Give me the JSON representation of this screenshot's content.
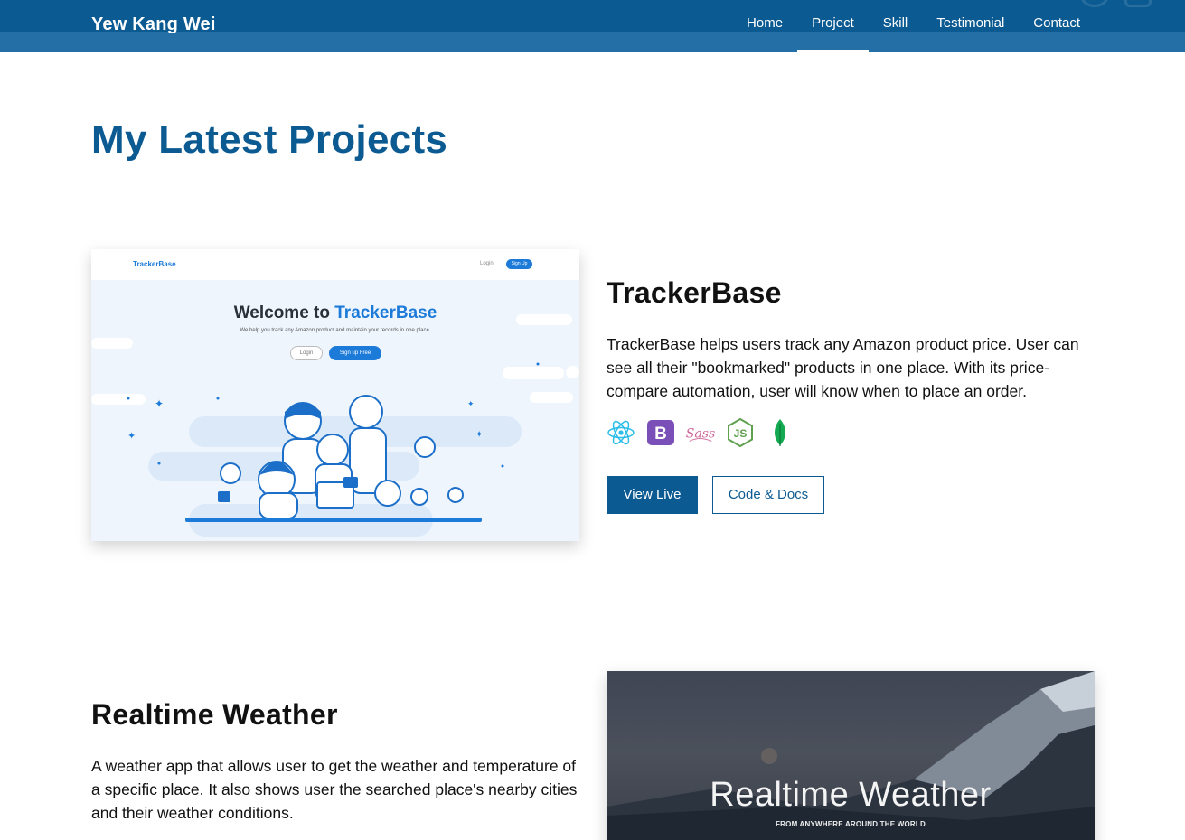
{
  "nav": {
    "brand": "Yew Kang Wei",
    "items": [
      {
        "label": "Home",
        "active": false
      },
      {
        "label": "Project",
        "active": true
      },
      {
        "label": "Skill",
        "active": false
      },
      {
        "label": "Testimonial",
        "active": false
      },
      {
        "label": "Contact",
        "active": false
      }
    ]
  },
  "section": {
    "title": "My Latest Projects"
  },
  "projects": [
    {
      "title": "TrackerBase",
      "description": "TrackerBase helps users track any Amazon product price. User can see all their \"bookmarked\" products in one place. With its price-compare automation, user will know when to place an order.",
      "techs": [
        "react-icon",
        "bootstrap-icon",
        "sass-icon",
        "nodejs-icon",
        "mongodb-icon"
      ],
      "buttons": {
        "live": "View Live",
        "code": "Code & Docs"
      },
      "screenshot": {
        "brand": "TrackerBase",
        "login": "Login",
        "signup": "Sign Up",
        "welcome": "Welcome to",
        "welcome_brand": "TrackerBase",
        "tagline": "We help you track any Amazon product and maintain your records in one place.",
        "btn_login": "Login",
        "btn_signup": "Sign up Free"
      }
    },
    {
      "title": "Realtime Weather",
      "description": "A weather app that allows user to get the weather and temperature of a specific place. It also shows user the searched place's nearby cities and their weather conditions.",
      "screenshot": {
        "title": "Realtime Weather",
        "subtitle": "FROM ANYWHERE AROUND THE WORLD"
      }
    }
  ],
  "colors": {
    "primary": "#0b5a92",
    "accent": "#1c7ad8",
    "nav_band": "#2470a6"
  }
}
